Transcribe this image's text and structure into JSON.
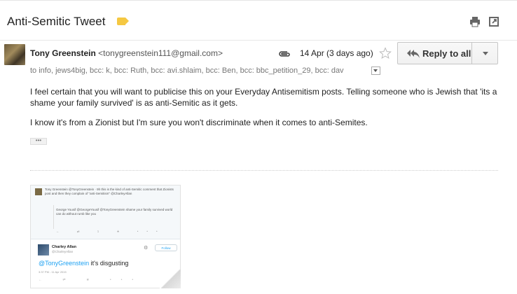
{
  "email": {
    "subject": "Anti-Semitic Tweet",
    "label_color": "#f5c842",
    "sender_name": "Tony Greenstein",
    "sender_email": "<tonygreenstein111@gmail.com>",
    "date": "14 Apr (3 days ago)",
    "reply_all_label": "Reply to all",
    "recipients": "to info, jews4big, bcc: k, bcc: Ruth, bcc: avi.shlaim, bcc: Ben, bcc: bbc_petition_29, bcc: dav",
    "body_paragraph_1": "I feel certain that you will want to publicise this on your Everyday Antisemitism posts.  Telling someone who is Jewish that 'its a shame your family survived' is as anti-Semitic as it gets.",
    "body_paragraph_2": "I know it's from a Zionist but I'm sure you won't discriminate when it comes to anti-Semites.",
    "ellipsis": "•••"
  },
  "icons": {
    "print": "print-icon",
    "new_window": "new-window-icon",
    "attachment": "paperclip-icon",
    "star": "star-icon",
    "reply_all": "reply-all-icon",
    "more": "chevron-down-icon"
  },
  "embedded_tweet": {
    "top_text": "Tony Greenstein @TonyGreenstein · 9h  this is the kind of anti-Semitic comment that Zionists post and then they complain of \"anti-Semitism\" @CharleyAllan",
    "quoted_text": "George Yousif @GeorgeYousif  @TonyGreenstein shame your family survived world can do without rumb like you",
    "actions": "← ⇄ 1 ★ •••",
    "reply_author": "Charley Allan",
    "reply_handle": "@CharleyAllan",
    "follow_label": "Follow",
    "reply_mention": "@TonyGreenstein",
    "reply_text": " it's disgusting",
    "reply_meta": "3:37 PM - 11 Apr 2015",
    "reply_actions": "← ⇄ ★ •••",
    "link_color": "#1da1f2"
  }
}
